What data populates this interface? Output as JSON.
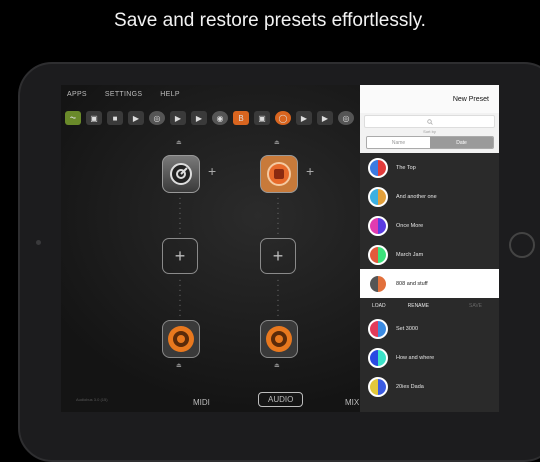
{
  "headline": "Save and restore presets effortlessly.",
  "menu": {
    "apps": "APPS",
    "settings": "SETTINGS",
    "help": "HELP"
  },
  "tabs": {
    "midi": "MIDI",
    "audio": "AUDIO",
    "mix": "MIX"
  },
  "version": "Audiobus 3.0 (15)",
  "popover": {
    "title": "New Preset",
    "search_placeholder": "",
    "sort_by": "Sort by",
    "sort_name": "Name",
    "sort_date": "Date",
    "actions": {
      "load": "LOAD",
      "rename": "RENAME",
      "save": "SAVE"
    },
    "presets_top": [
      {
        "name": "The Top",
        "colors": [
          "#e23b3b",
          "#3b7be2"
        ]
      },
      {
        "name": "And another one",
        "colors": [
          "#e2a03b",
          "#3bb0e2"
        ]
      },
      {
        "name": "Once More",
        "colors": [
          "#5a3be2",
          "#e23bb0"
        ]
      },
      {
        "name": "March Jam",
        "colors": [
          "#3be27a",
          "#e25a3b"
        ]
      },
      {
        "name": "808 and stuff",
        "colors": [
          "#e2703b",
          "#555555"
        ],
        "selected": true
      }
    ],
    "presets_bottom": [
      {
        "name": "Set 3000",
        "colors": [
          "#3b8be2",
          "#e23b5a"
        ]
      },
      {
        "name": "How and where",
        "colors": [
          "#3be2c8",
          "#2a4ae2"
        ]
      },
      {
        "name": "20ies Dada",
        "colors": [
          "#3b5be2",
          "#e2c83b"
        ]
      }
    ]
  }
}
